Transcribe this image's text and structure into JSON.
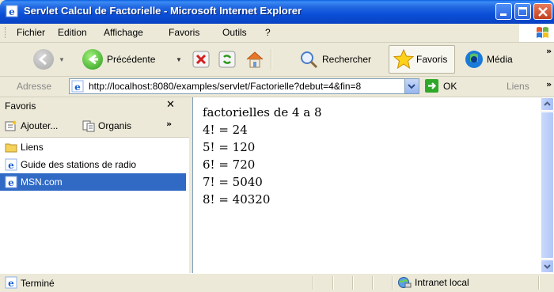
{
  "window": {
    "title": "Servlet Calcul de Factorielle - Microsoft Internet Explorer"
  },
  "menu": [
    "Fichier",
    "Edition",
    "Affichage",
    "Favoris",
    "Outils",
    "?"
  ],
  "toolbar": {
    "back_label": "Précédente",
    "search_label": "Rechercher",
    "favorites_label": "Favoris",
    "media_label": "Média"
  },
  "address": {
    "label": "Adresse",
    "url": "http://localhost:8080/examples/servlet/Factorielle?debut=4&fin=8",
    "go_label": "OK",
    "links_label": "Liens"
  },
  "sidebar": {
    "title": "Favoris",
    "add_label": "Ajouter...",
    "organize_label": "Organis",
    "items": [
      {
        "label": "Liens",
        "icon": "folder-icon"
      },
      {
        "label": "Guide des stations de radio",
        "icon": "ie-page-icon"
      },
      {
        "label": "MSN.com",
        "icon": "ie-page-icon",
        "selected": true
      }
    ]
  },
  "content": {
    "lines": [
      "factorielles de 4 a 8",
      "4! = 24",
      "5! = 120",
      "6! = 720",
      "7! = 5040",
      "8! = 40320"
    ]
  },
  "status": {
    "text": "Terminé",
    "zone": "Intranet local"
  },
  "colors": {
    "titlebar": "#0b4fd8",
    "selection": "#316ac5",
    "close_button": "#c3401c"
  }
}
